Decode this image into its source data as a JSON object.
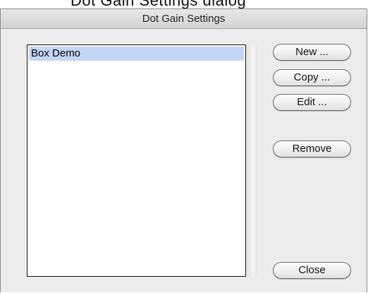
{
  "window": {
    "title": "Dot Gain Settings"
  },
  "list": {
    "items": [
      {
        "label": "Box Demo",
        "selected": true
      }
    ]
  },
  "buttons": {
    "new": "New ...",
    "copy": "Copy ...",
    "edit": "Edit ...",
    "remove": "Remove",
    "close": "Close"
  },
  "colors": {
    "selection": "#c3d6f5",
    "window_bg": "#ececec"
  }
}
